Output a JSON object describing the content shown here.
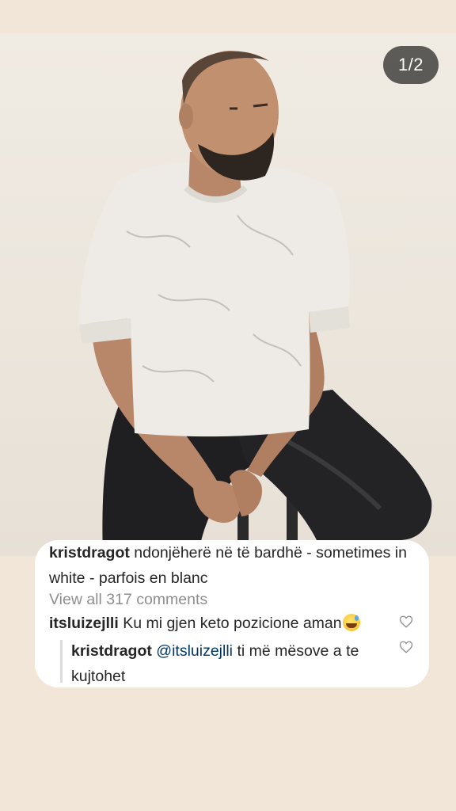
{
  "story": {
    "counter": "1/2",
    "photo_subject": "man in white t-shirt seated on stool"
  },
  "post": {
    "caption_user": "kristdragot",
    "caption_text": "ndonjëherë në të bardhë - sometimes in white - parfois en blanc",
    "view_all": "View all 317 comments",
    "comment_user": "itsluizejlli",
    "comment_text": "Ku mi gjen keto pozicione aman",
    "comment_emoji": "sweat-smile-emoji",
    "reply_user": "kristdragot",
    "reply_mention": "@itsluizejlli",
    "reply_text": "ti më mësove a te kujtohet"
  },
  "colors": {
    "background": "#f2e6d8",
    "mention": "#00376b",
    "muted": "#8e8e8e"
  }
}
